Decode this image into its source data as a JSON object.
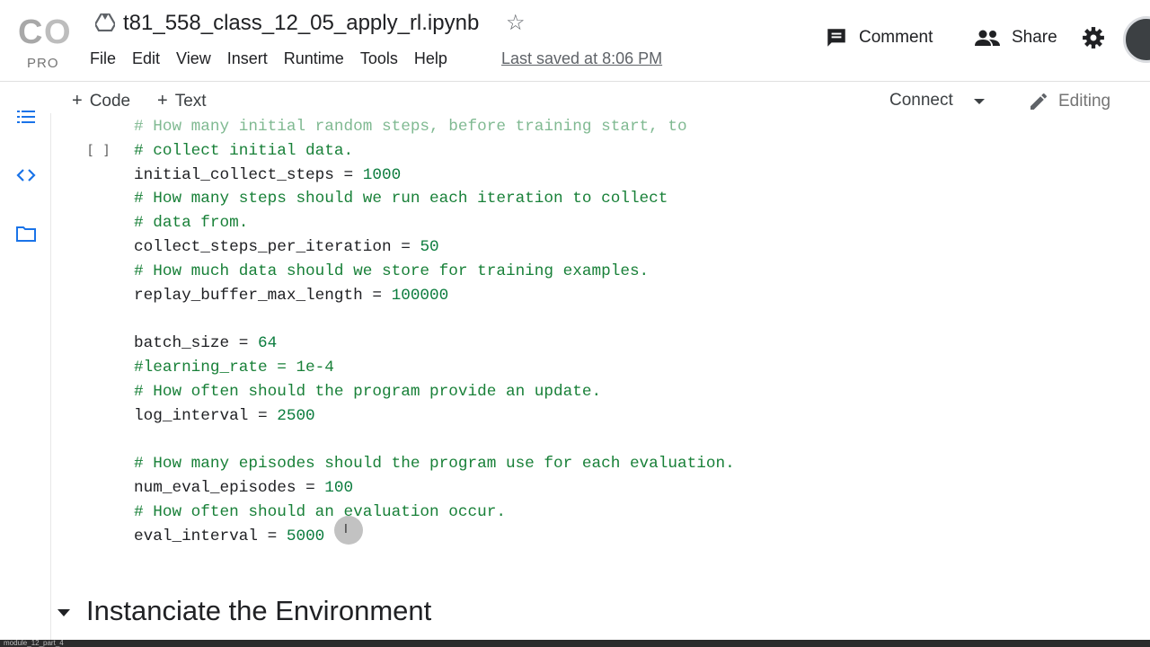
{
  "app": {
    "logo_text": "CO",
    "logo_sub": "PRO",
    "notebook_title": "t81_558_class_12_05_apply_rl.ipynb",
    "last_saved": "Last saved at 8:06 PM"
  },
  "menu": {
    "items": [
      "File",
      "Edit",
      "View",
      "Insert",
      "Runtime",
      "Tools",
      "Help"
    ]
  },
  "header_actions": {
    "comment": "Comment",
    "share": "Share"
  },
  "toolbar": {
    "add_code": "Code",
    "add_text": "Text",
    "connect": "Connect",
    "editing": "Editing"
  },
  "cell": {
    "run_brackets": "[ ]",
    "lines": [
      {
        "kind": "comment",
        "text": "# How many initial random steps, before training start, to"
      },
      {
        "kind": "comment",
        "text": "# collect initial data."
      },
      {
        "kind": "assign",
        "name": "initial_collect_steps",
        "value": "1000"
      },
      {
        "kind": "comment",
        "text": "# How many steps should we run each iteration to collect"
      },
      {
        "kind": "comment",
        "text": "# data from."
      },
      {
        "kind": "assign",
        "name": "collect_steps_per_iteration",
        "value": "50"
      },
      {
        "kind": "comment",
        "text": "# How much data should we store for training examples."
      },
      {
        "kind": "assign",
        "name": "replay_buffer_max_length",
        "value": "100000"
      },
      {
        "kind": "blank",
        "text": ""
      },
      {
        "kind": "assign",
        "name": "batch_size",
        "value": "64"
      },
      {
        "kind": "comment",
        "text": "#learning_rate = 1e-4"
      },
      {
        "kind": "comment",
        "text": "# How often should the program provide an update."
      },
      {
        "kind": "assign",
        "name": "log_interval",
        "value": "2500"
      },
      {
        "kind": "blank",
        "text": ""
      },
      {
        "kind": "comment",
        "text": "# How many episodes should the program use for each evaluation."
      },
      {
        "kind": "assign",
        "name": "num_eval_episodes",
        "value": "100"
      },
      {
        "kind": "comment",
        "text": "# How often should an evaluation occur."
      },
      {
        "kind": "assign",
        "name": "eval_interval",
        "value": "5000"
      }
    ]
  },
  "section": {
    "title": "Instanciate the Environment"
  },
  "taskbar": {
    "tab_label": "module_12_part_4"
  },
  "colors": {
    "comment": "#188038",
    "number": "#0b7c3e",
    "logo_orange": "#f9ab00",
    "logo_gray": "#9e9e9e"
  }
}
